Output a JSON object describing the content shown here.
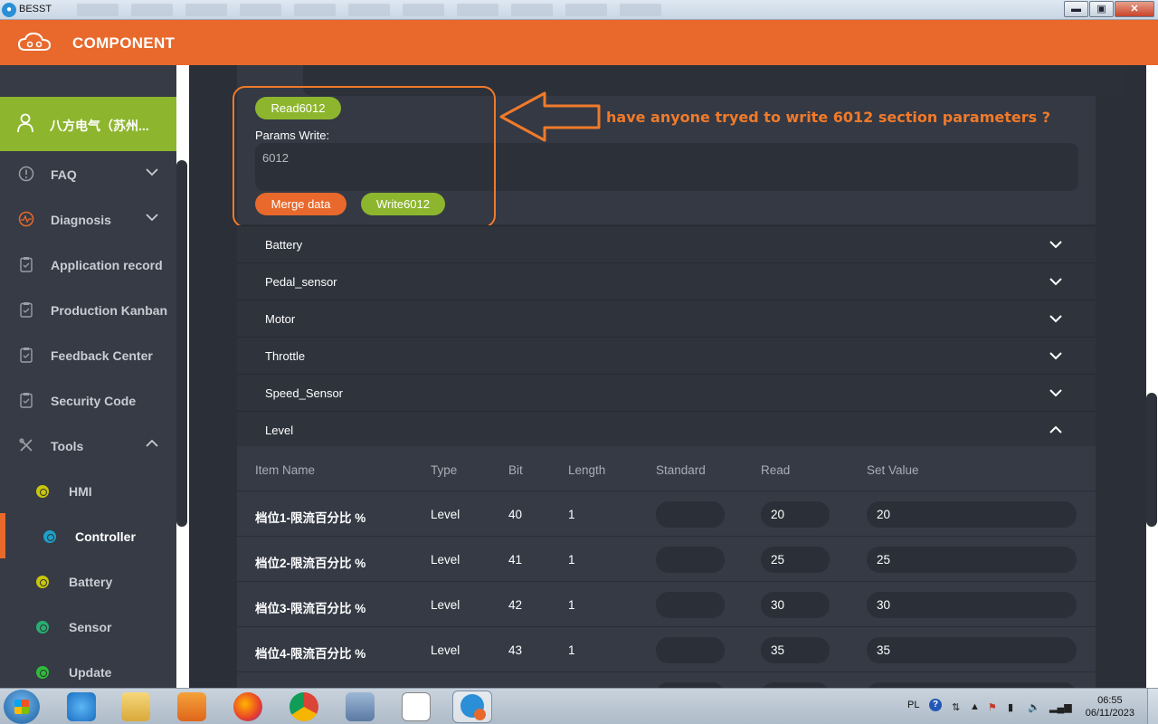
{
  "window": {
    "title": "BESST",
    "min": "▬",
    "max": "▣",
    "close": "✕"
  },
  "header": {
    "title": "COMPONENT"
  },
  "sidebar": {
    "user": "八方电气（苏州...",
    "items": [
      {
        "label": "FAQ",
        "icon": "info-icon"
      },
      {
        "label": "Diagnosis",
        "icon": "pulse-icon"
      },
      {
        "label": "Application record",
        "icon": "clipboard-icon"
      },
      {
        "label": "Production Kanban",
        "icon": "clipboard-icon"
      },
      {
        "label": "Feedback Center",
        "icon": "clipboard-icon"
      },
      {
        "label": "Security Code",
        "icon": "clipboard-icon"
      },
      {
        "label": "Tools",
        "icon": "tools-icon"
      }
    ],
    "sub": [
      {
        "label": "HMI",
        "color": "#c8c60a"
      },
      {
        "label": "Controller",
        "color": "#1e9fc8"
      },
      {
        "label": "Battery",
        "color": "#c8c60a"
      },
      {
        "label": "Sensor",
        "color": "#27ae73"
      },
      {
        "label": "Update",
        "color": "#2dbb3a"
      }
    ]
  },
  "params": {
    "read_value_partial": "6012",
    "read_button": "Read6012",
    "write_label": "Params Write:",
    "write_value": "6012",
    "merge_button": "Merge data",
    "write_button": "Write6012"
  },
  "annotation": {
    "text": "have anyone tryed to write 6012 section parameters ?"
  },
  "sections": [
    "Battery",
    "Pedal_sensor",
    "Motor",
    "Throttle",
    "Speed_Sensor",
    "Level"
  ],
  "table": {
    "headers": [
      "Item Name",
      "Type",
      "Bit",
      "Length",
      "Standard",
      "Read",
      "Set Value"
    ],
    "rows": [
      {
        "name": "档位1-限流百分比 %",
        "type": "Level",
        "bit": "40",
        "length": "1",
        "standard": "",
        "read": "20",
        "set": "20"
      },
      {
        "name": "档位2-限流百分比 %",
        "type": "Level",
        "bit": "41",
        "length": "1",
        "standard": "",
        "read": "25",
        "set": "25"
      },
      {
        "name": "档位3-限流百分比 %",
        "type": "Level",
        "bit": "42",
        "length": "1",
        "standard": "",
        "read": "30",
        "set": "30"
      },
      {
        "name": "档位4-限流百分比 %",
        "type": "Level",
        "bit": "43",
        "length": "1",
        "standard": "",
        "read": "35",
        "set": "35"
      }
    ]
  },
  "taskbar": {
    "lang": "PL",
    "help": "?",
    "time": "06:55",
    "date": "06/11/2023"
  },
  "colors": {
    "accent": "#e8692b",
    "green": "#8db62e",
    "sidebar": "#363b45",
    "main": "#2b2f38"
  }
}
